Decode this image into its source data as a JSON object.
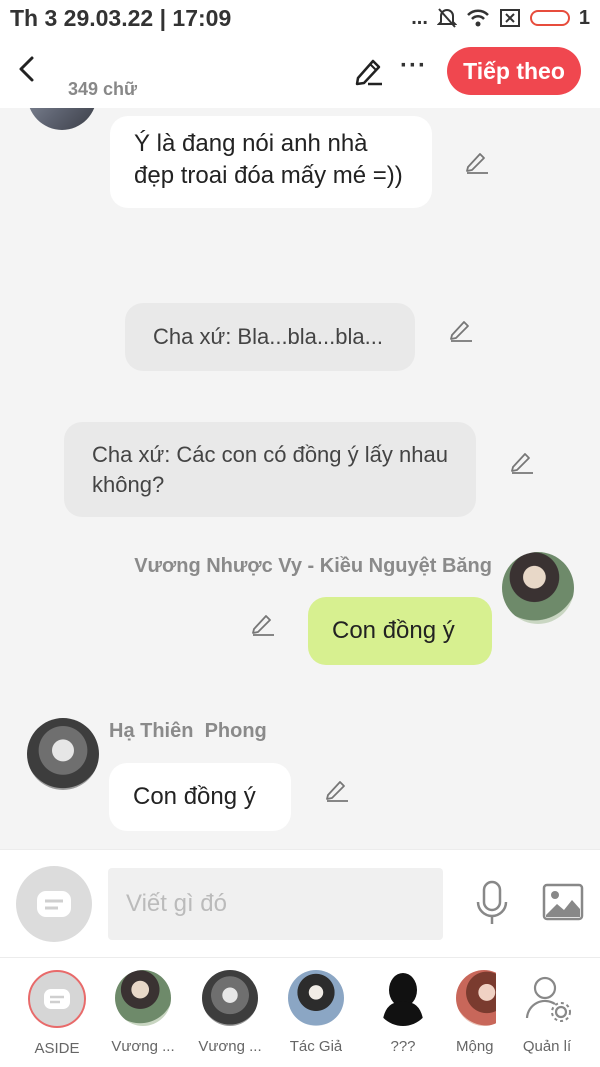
{
  "status_bar": {
    "time": "Th 3 29.03.22 | 17:09",
    "dots": "...",
    "signal_level": "1",
    "icons": [
      "silent-bell-icon",
      "wifi-icon",
      "sim-icon",
      "battery-icon"
    ]
  },
  "header": {
    "word_count": "349 chữ",
    "more_label": "···",
    "next_label": "Tiếp theo",
    "accent_color": "#f0474f"
  },
  "messages": [
    {
      "type": "left",
      "text": "Ý là đang nói anh nhà đẹp troai đóa mấy mé =))"
    },
    {
      "type": "narration",
      "text": "Cha xứ: Bla...bla...bla..."
    },
    {
      "type": "narration",
      "text": "Cha xứ: Các con có đồng ý lấy nhau không?"
    },
    {
      "type": "right",
      "sender": "Vương Nhược Vy - Kiều Nguyệt Băng",
      "text": "Con đồng ý",
      "bubble_color": "#d7f090"
    },
    {
      "type": "left",
      "sender": "Hạ Thiên  Phong",
      "text": "Con đồng ý"
    }
  ],
  "input": {
    "placeholder": "Viết gì đó"
  },
  "tabs": [
    {
      "label": "ASIDE"
    },
    {
      "label": "Vương ..."
    },
    {
      "label": "Vương ..."
    },
    {
      "label": "Tác Giả"
    },
    {
      "label": "???"
    },
    {
      "label": "Mộng"
    },
    {
      "label": "Quản lí"
    }
  ]
}
